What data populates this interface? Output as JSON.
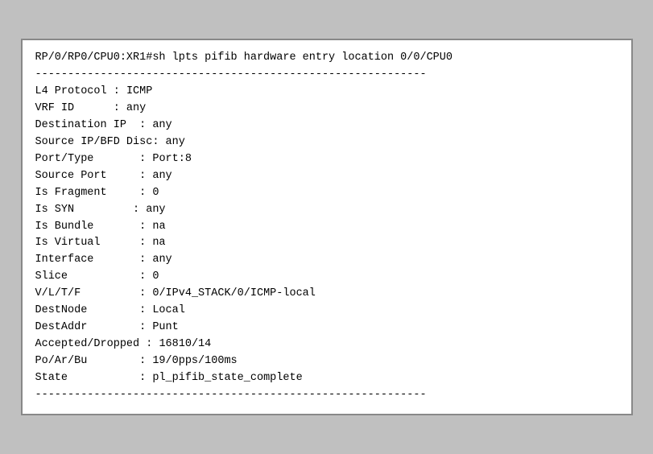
{
  "terminal": {
    "command_line": "RP/0/RP0/CPU0:XR1#sh lpts pifib hardware entry location 0/0/CPU0",
    "separator": "------------------------------------------------------------",
    "entries": [
      {
        "key": "L4 Protocol",
        "separator": " : ",
        "value": "ICMP"
      },
      {
        "key": "VRF ID",
        "separator": "      : ",
        "value": "any"
      },
      {
        "key": "Destination IP",
        "separator": "  : ",
        "value": "any"
      },
      {
        "key": "Source IP/BFD Disc",
        "separator": ": ",
        "value": "any"
      },
      {
        "key": "Port/Type",
        "separator": "       : ",
        "value": "Port:8"
      },
      {
        "key": "Source Port",
        "separator": "     : ",
        "value": "any"
      },
      {
        "key": "Is Fragment",
        "separator": "     : ",
        "value": "0"
      },
      {
        "key": "Is SYN",
        "separator": "         : ",
        "value": "any"
      },
      {
        "key": "Is Bundle",
        "separator": "       : ",
        "value": "na"
      },
      {
        "key": "Is Virtual",
        "separator": "      : ",
        "value": "na"
      },
      {
        "key": "Interface",
        "separator": "       : ",
        "value": "any"
      },
      {
        "key": "Slice",
        "separator": "           : ",
        "value": "0"
      },
      {
        "key": "V/L/T/F",
        "separator": "         : ",
        "value": "0/IPv4_STACK/0/ICMP-local"
      },
      {
        "key": "DestNode",
        "separator": "        : ",
        "value": "Local"
      },
      {
        "key": "DestAddr",
        "separator": "        : ",
        "value": "Punt"
      },
      {
        "key": "Accepted/Dropped",
        "separator": " : ",
        "value": "16810/14"
      },
      {
        "key": "Po/Ar/Bu",
        "separator": "        : ",
        "value": "19/0pps/100ms"
      },
      {
        "key": "State",
        "separator": "           : ",
        "value": "pl_pifib_state_complete"
      }
    ]
  }
}
